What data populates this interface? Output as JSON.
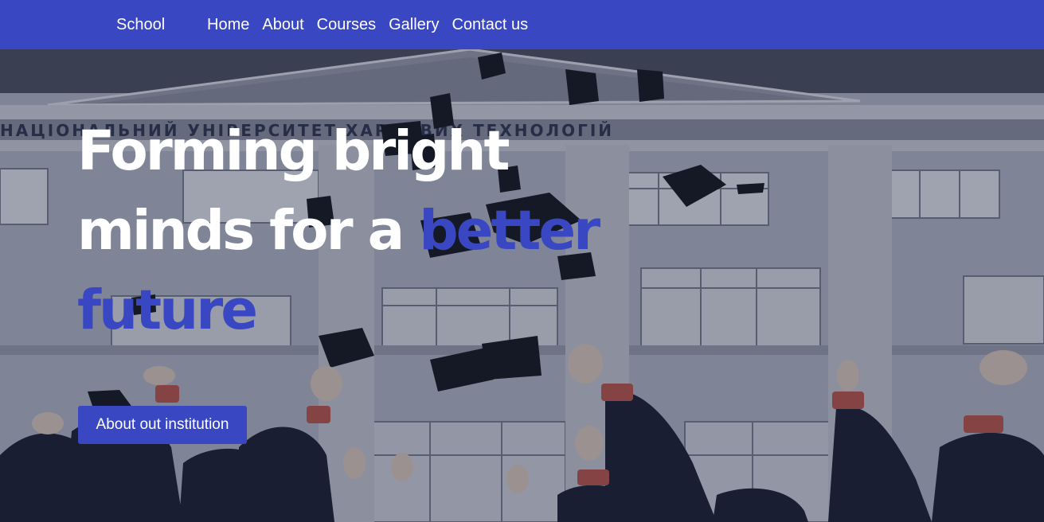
{
  "nav": {
    "brand": "School",
    "links": [
      "Home",
      "About",
      "Courses",
      "Gallery",
      "Contact us"
    ]
  },
  "hero": {
    "headline_part1": "Forming bright minds for a ",
    "headline_accent": "better future",
    "cta_label": "About out institution",
    "building_inscription": "НАЦІОНАЛЬНИЙ УНІВЕРСИТЕТ ХАРЧОВИХ ТЕХНОЛОГІЙ"
  },
  "colors": {
    "primary": "#3a47c2",
    "text_light": "#ffffff"
  }
}
